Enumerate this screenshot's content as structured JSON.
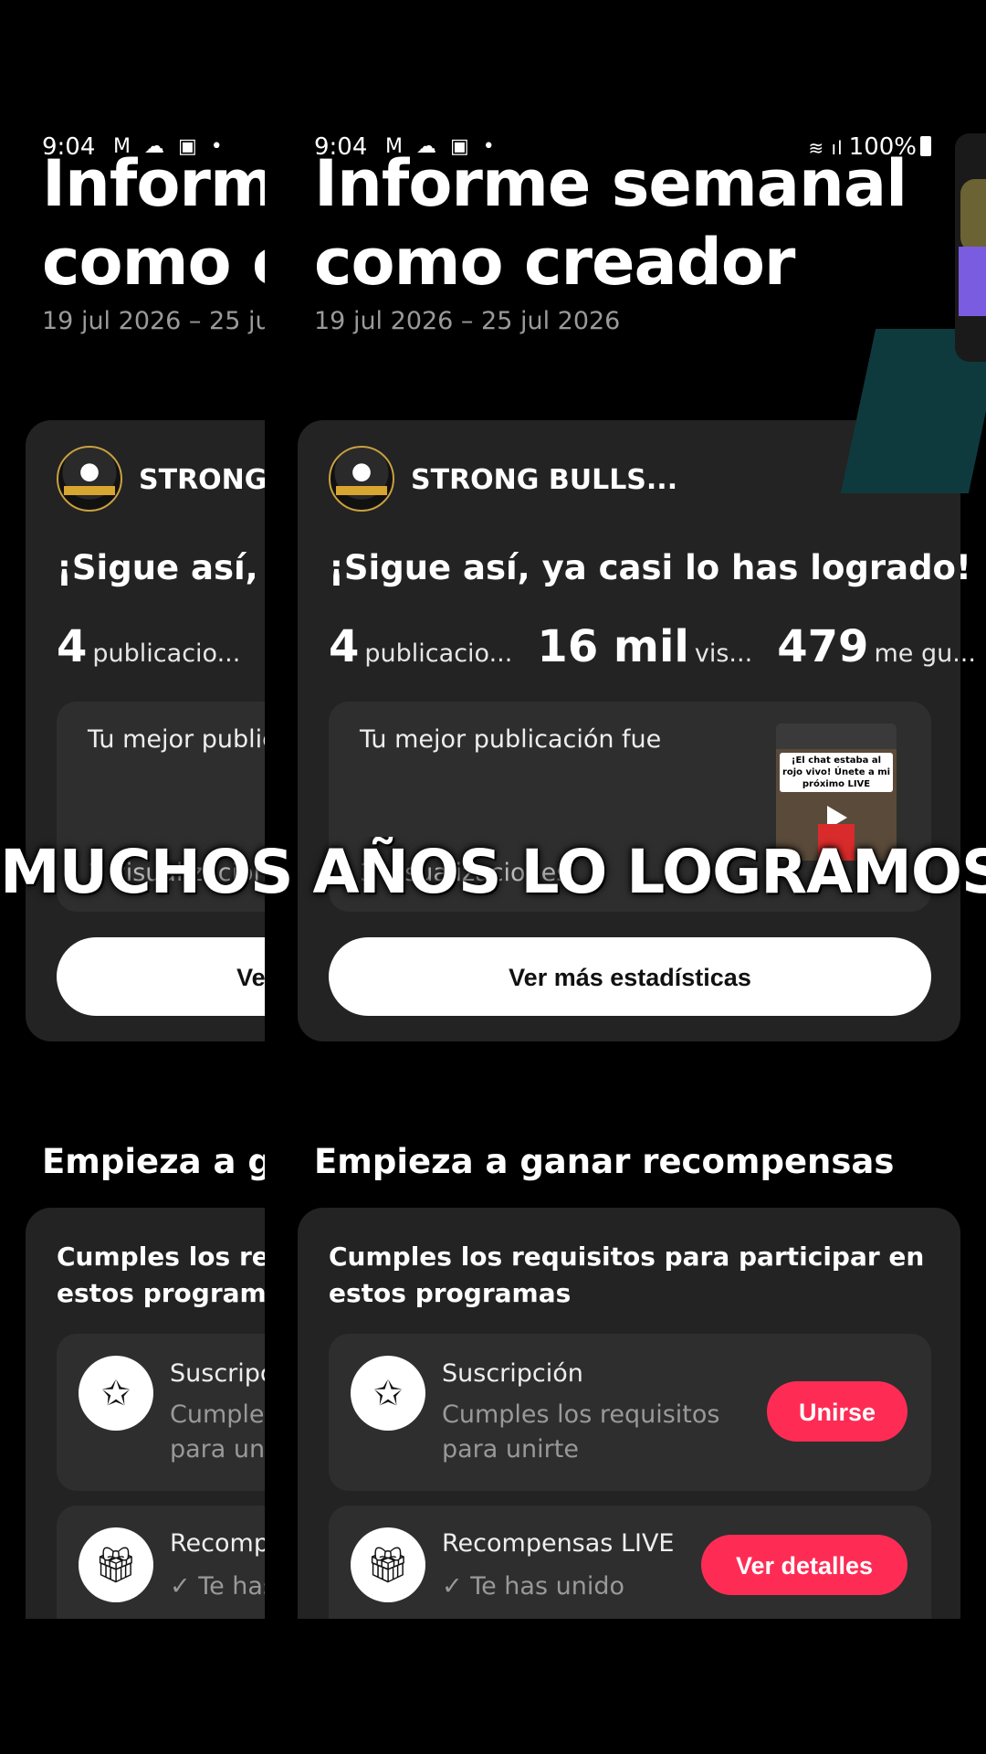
{
  "status": {
    "time": "9:04",
    "notif_icons": "M ☁ ▣ •",
    "signal": "📶",
    "battery": "100%"
  },
  "report": {
    "title_line1": "Informe semanal",
    "title_line2": "como creador",
    "dates": "19 jul 2026 – 25 jul 2026"
  },
  "creator": {
    "name": "STRONG BULLS..."
  },
  "card": {
    "cheer": "¡Sigue así, ya casi lo has logrado!",
    "stats": [
      {
        "num": "4",
        "label": "publicacio..."
      },
      {
        "num": "16 mil",
        "label": "vis..."
      },
      {
        "num": "479",
        "label": "me gu..."
      }
    ],
    "best_label": "Tu mejor publicación fue",
    "best_views": "3 visualizaciones",
    "thumb_caption": "¡El chat estaba al rojo vivo! Únete a mi próximo LIVE",
    "stats_button": "Ver más estadísticas"
  },
  "rewards": {
    "section_title": "Empieza a ganar recompensas",
    "requirement": "Cumples los requisitos para participar en estos programas",
    "programs": [
      {
        "icon": "star-icon",
        "title": "Suscripción",
        "desc": "Cumples los requisitos para unirte",
        "button": "Unirse"
      },
      {
        "icon": "gift-icon",
        "title": "Recompensas LIVE",
        "desc": "✓ Te has unido",
        "button": "Ver detalles"
      }
    ]
  },
  "overlay_text": "MUCHOS AÑOS LO LOGRAMOS..GRACIAS"
}
